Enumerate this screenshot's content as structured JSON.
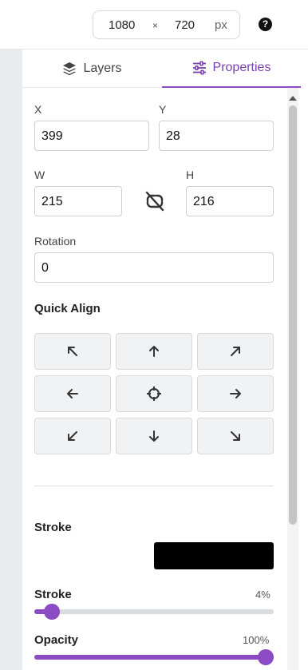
{
  "canvas_size": {
    "width": "1080",
    "times": "×",
    "height": "720",
    "unit": "px"
  },
  "help": {
    "icon": "question-circle-icon",
    "glyph": "?"
  },
  "tabs": [
    {
      "label": "Layers",
      "icon": "layers-icon"
    },
    {
      "label": "Properties",
      "icon": "sliders-icon"
    }
  ],
  "position": {
    "x_label": "X",
    "x_value": "399",
    "y_label": "Y",
    "y_value": "28"
  },
  "size": {
    "w_label": "W",
    "w_value": "215",
    "h_label": "H",
    "h_value": "216",
    "lock_icon": "unlink-icon"
  },
  "rotation": {
    "label": "Rotation",
    "value": "0"
  },
  "quick_align": {
    "title": "Quick Align",
    "buttons": [
      "arrow-up-left-icon",
      "arrow-up-icon",
      "arrow-up-right-icon",
      "arrow-left-icon",
      "crosshair-icon",
      "arrow-right-icon",
      "arrow-down-left-icon",
      "arrow-down-icon",
      "arrow-down-right-icon"
    ]
  },
  "stroke_color": {
    "label": "Stroke",
    "color": "#000000"
  },
  "stroke_width": {
    "label": "Stroke",
    "value_text": "4%",
    "value": 0.04
  },
  "opacity": {
    "label": "Opacity",
    "value_text": "100%",
    "value": 1.0
  },
  "colors": {
    "accent": "#8a4bc4"
  }
}
